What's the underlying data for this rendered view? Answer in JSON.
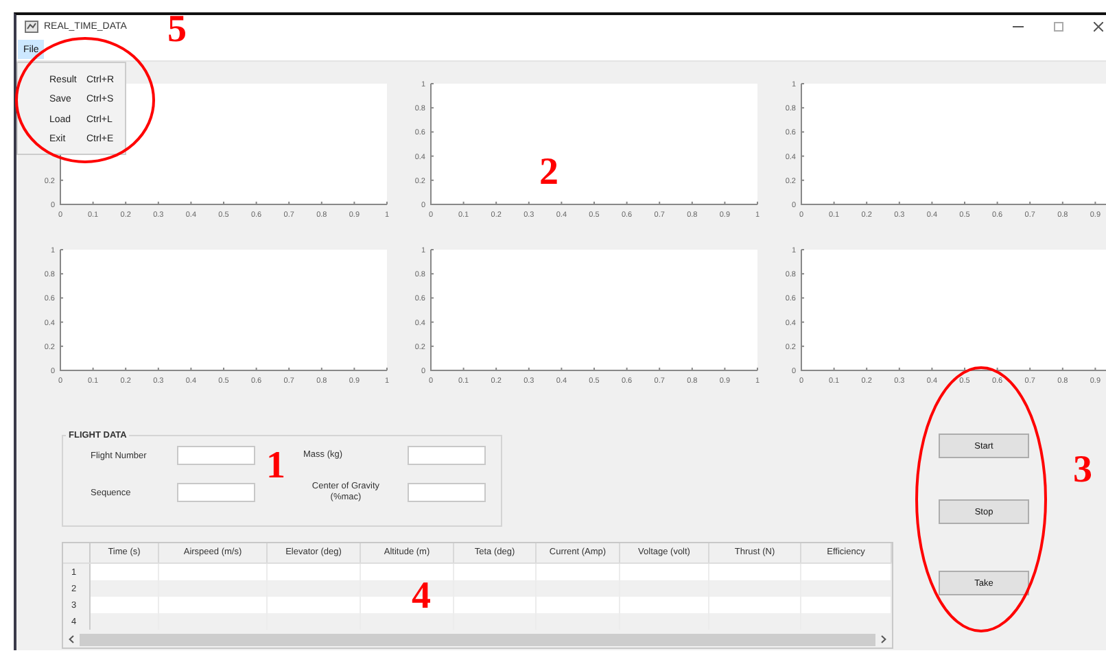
{
  "window": {
    "title": "REAL_TIME_DATA"
  },
  "menu_bar": [
    {
      "label": "File",
      "selected": true
    }
  ],
  "file_menu": [
    {
      "label": "Result",
      "shortcut": "Ctrl+R"
    },
    {
      "label": "Save",
      "shortcut": "Ctrl+S"
    },
    {
      "label": "Load",
      "shortcut": "Ctrl+L"
    },
    {
      "label": "Exit",
      "shortcut": "Ctrl+E"
    }
  ],
  "plots": [
    {
      "xticks": [
        "0",
        "0.1",
        "0.2",
        "0.3",
        "0.4",
        "0.5",
        "0.6",
        "0.7",
        "0.8",
        "0.9",
        "1"
      ],
      "yticks": [
        "0.2",
        "0"
      ]
    },
    {
      "xticks": [
        "0",
        "0.1",
        "0.2",
        "0.3",
        "0.4",
        "0.5",
        "0.6",
        "0.7",
        "0.8",
        "0.9",
        "1"
      ],
      "yticks": [
        "1",
        "0.8",
        "0.6",
        "0.4",
        "0.2",
        "0"
      ]
    },
    {
      "xticks": [
        "0",
        "0.1",
        "0.2",
        "0.3",
        "0.4",
        "0.5",
        "0.6",
        "0.7",
        "0.8",
        "0.9"
      ],
      "yticks": [
        "1",
        "0.8",
        "0.6",
        "0.4",
        "0.2",
        "0"
      ]
    },
    {
      "xticks": [
        "0",
        "0.1",
        "0.2",
        "0.3",
        "0.4",
        "0.5",
        "0.6",
        "0.7",
        "0.8",
        "0.9",
        "1"
      ],
      "yticks": [
        "1",
        "0.8",
        "0.6",
        "0.4",
        "0.2",
        "0"
      ]
    },
    {
      "xticks": [
        "0",
        "0.1",
        "0.2",
        "0.3",
        "0.4",
        "0.5",
        "0.6",
        "0.7",
        "0.8",
        "0.9",
        "1"
      ],
      "yticks": [
        "1",
        "0.8",
        "0.6",
        "0.4",
        "0.2",
        "0"
      ]
    },
    {
      "xticks": [
        "0",
        "0.1",
        "0.2",
        "0.3",
        "0.4",
        "0.5",
        "0.6",
        "0.7",
        "0.8",
        "0.9"
      ],
      "yticks": [
        "1",
        "0.8",
        "0.6",
        "0.4",
        "0.2",
        "0"
      ]
    }
  ],
  "flight_data": {
    "title": "FLIGHT DATA",
    "fields": [
      {
        "label": "Flight Number"
      },
      {
        "label": "Mass (kg)"
      },
      {
        "label": "Sequence"
      },
      {
        "label": "Center of Gravity (%mac)"
      }
    ]
  },
  "table": {
    "columns": [
      "Time (s)",
      "Airspeed (m/s)",
      "Elevator (deg)",
      "Altitude (m)",
      "Teta (deg)",
      "Current (Amp)",
      "Voltage (volt)",
      "Thrust (N)",
      "Efficiency"
    ],
    "row_numbers": [
      "1",
      "2",
      "3",
      "4"
    ]
  },
  "buttons": [
    "Start",
    "Stop",
    "Take"
  ],
  "callouts": [
    {
      "label": "5",
      "circled": true
    },
    {
      "label": "2",
      "circled": false
    },
    {
      "label": "1",
      "circled": false
    },
    {
      "label": "3",
      "circled": true
    },
    {
      "label": "4",
      "circled": false
    }
  ]
}
